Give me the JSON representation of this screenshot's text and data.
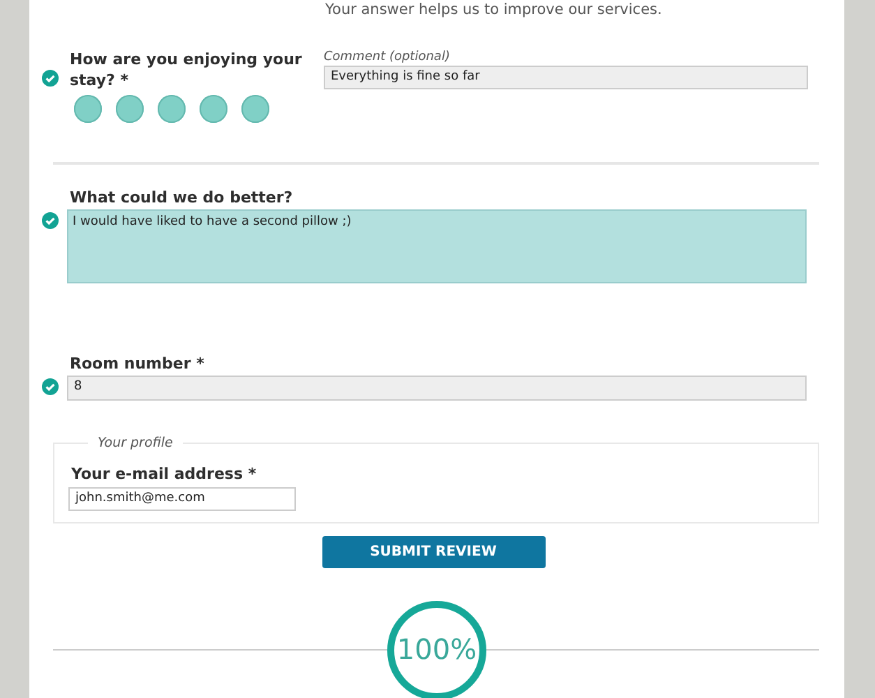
{
  "intro": "Your answer helps us to improve our services.",
  "rating": {
    "label": "How are you enjoying your stay? *",
    "valid": true,
    "stars": 5,
    "comment_label": "Comment (optional)",
    "comment": "Everything is fine so far"
  },
  "better": {
    "label": "What could we do better?",
    "valid": true,
    "value": "I would have liked to have a second pillow ;)"
  },
  "room": {
    "label": "Room number *",
    "valid": true,
    "value": "8"
  },
  "profile": {
    "legend": "Your profile",
    "email_label": "Your e-mail address *",
    "email": "john.smith@me.com"
  },
  "submit": "SUBMIT REVIEW",
  "progress": {
    "level": 1,
    "text": "100%"
  }
}
